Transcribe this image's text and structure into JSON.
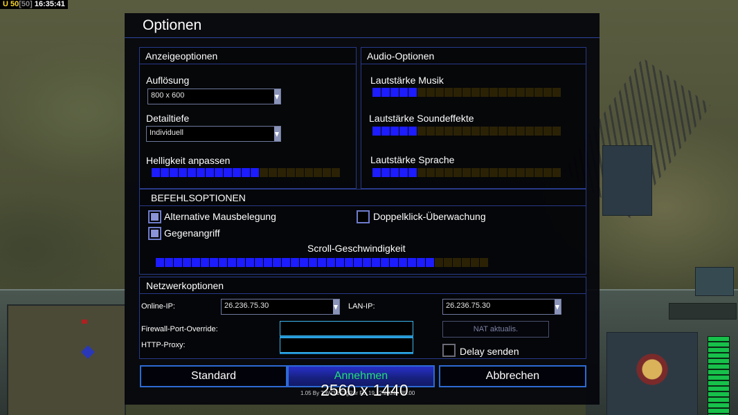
{
  "hud": {
    "u_label": "U 50",
    "bracket": "[50]",
    "time": "16:35:41"
  },
  "dialog": {
    "title": "Optionen",
    "display": {
      "header": "Anzeigeoptionen",
      "resolution_label": "Auflösung",
      "resolution_value": "800 x 600",
      "detail_label": "Detailtiefe",
      "detail_value": "Individuell",
      "brightness_label": "Helligkeit anpassen",
      "brightness_level": 0.57
    },
    "audio": {
      "header": "Audio-Optionen",
      "music_label": "Lautstärke Musik",
      "music_level": 0.24,
      "sfx_label": "Lautstärke Soundeffekte",
      "sfx_level": 0.24,
      "speech_label": "Lautstärke Sprache",
      "speech_level": 0.24
    },
    "commands": {
      "header": "BEFEHLSOPTIONEN",
      "alt_mouse_label": "Alternative Mausbelegung",
      "alt_mouse_checked": true,
      "doubleclick_label": "Doppelklick-Überwachung",
      "doubleclick_checked": false,
      "counter_label": "Gegenangriff",
      "counter_checked": true,
      "scroll_label": "Scroll-Geschwindigkeit",
      "scroll_level": 0.84
    },
    "network": {
      "header": "Netzwerkoptionen",
      "online_ip_label": "Online-IP:",
      "online_ip_value": "26.236.75.30",
      "lan_ip_label": "LAN-IP:",
      "lan_ip_value": "26.236.75.30",
      "firewall_label": "Firewall-Port-Override:",
      "firewall_value": "",
      "proxy_label": "HTTP-Proxy:",
      "proxy_value": "",
      "nat_button": "NAT aktualis.",
      "delay_label": "Delay senden",
      "delay_checked": false
    },
    "buttons": {
      "standard": "Standard",
      "accept": "Annehmen",
      "cancel": "Abbrechen"
    },
    "version": "1.05 By T3W3lzF3gR3r Fix 19.12.2021 · 35.00",
    "overlay": "2560 x 1440"
  },
  "colors": {
    "slider_on": "#1c1cff",
    "slider_off": "#2b2205",
    "accent_border": "#283a8c",
    "accept_text": "#22e07a"
  }
}
